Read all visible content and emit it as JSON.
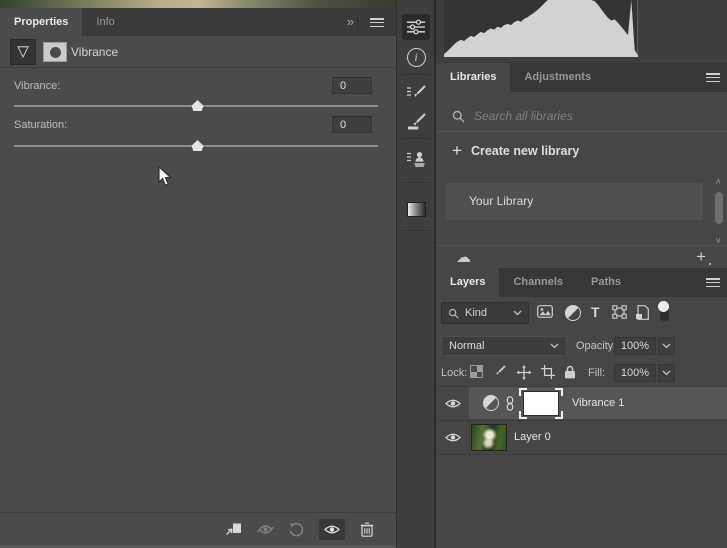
{
  "properties_panel": {
    "tabs": [
      {
        "label": "Properties",
        "active": true
      },
      {
        "label": "Info",
        "active": false
      }
    ],
    "collapse_glyph": "»",
    "header": {
      "title": "Vibrance"
    },
    "controls": [
      {
        "label": "Vibrance:",
        "value": "0",
        "slider_position": "center"
      },
      {
        "label": "Saturation:",
        "value": "0",
        "slider_position": "center"
      }
    ],
    "footer_icons": [
      "clip-to-layer",
      "view-previous-state",
      "reset-adjustment",
      "toggle-visibility",
      "delete-adjustment"
    ]
  },
  "dock": {
    "icons": [
      "properties",
      "info",
      "brush-settings",
      "brushes",
      "clone-source",
      "gradients"
    ],
    "active_icon": "properties",
    "info_glyph": "i"
  },
  "histogram": {
    "values": [
      5,
      10,
      16,
      22,
      27,
      30,
      28,
      33,
      37,
      35,
      40,
      44,
      42,
      47,
      50,
      48,
      53,
      51,
      56,
      58,
      56,
      61,
      64,
      62,
      67,
      70,
      74,
      78,
      83,
      88,
      94,
      100,
      100,
      100,
      100,
      100,
      100,
      100,
      100,
      100,
      100,
      100,
      100,
      100,
      100,
      98,
      92,
      84,
      76,
      69,
      64,
      66,
      60,
      53,
      46,
      38,
      100,
      12,
      3
    ],
    "fill_color": "#d2d2d2",
    "bg_color": "#343434"
  },
  "libraries_panel": {
    "tabs": [
      {
        "label": "Libraries",
        "active": true
      },
      {
        "label": "Adjustments",
        "active": false
      }
    ],
    "search_placeholder": "Search all libraries",
    "create_plus": "+",
    "create_label": "Create new library",
    "items": [
      {
        "label": "Your Library"
      }
    ],
    "cloud_glyph": "☁",
    "add_glyph": "+",
    "scroll_up": "∧",
    "scroll_down": "∨"
  },
  "layers_panel": {
    "tabs": [
      {
        "label": "Layers",
        "active": true
      },
      {
        "label": "Channels",
        "active": false
      },
      {
        "label": "Paths",
        "active": false
      }
    ],
    "filter": {
      "kind_label": "Kind",
      "type_glyph": "T"
    },
    "blend": {
      "mode": "Normal",
      "opacity_label": "Opacity:",
      "opacity_value": "100%"
    },
    "lock": {
      "label": "Lock:",
      "fill_label": "Fill:",
      "fill_value": "100%"
    },
    "layers": [
      {
        "name": "Vibrance 1",
        "type": "adjustment",
        "selected": true
      },
      {
        "name": "Layer 0",
        "type": "image",
        "selected": false
      }
    ]
  },
  "colors": {
    "panel_bg": "#4b4b4b",
    "right_panel_bg": "#464646",
    "tabbar_bg": "#3a3a3a",
    "selected_row": "#565656",
    "histogram_fill": "#d2d2d2",
    "text_bright": "#e8e8e8",
    "text_dim": "#999999"
  }
}
